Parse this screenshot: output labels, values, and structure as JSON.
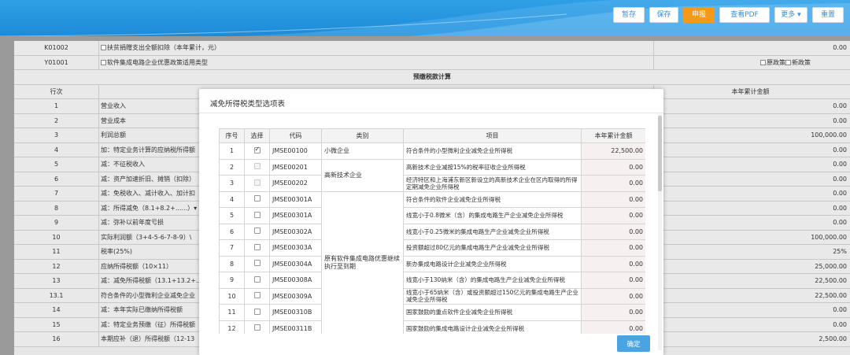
{
  "toolbar": {
    "buttons": [
      "暂存",
      "保存",
      "申报",
      "查看PDF",
      "更多",
      "重置"
    ]
  },
  "bg": {
    "rows": [
      {
        "code": "K01002",
        "label": "扶贫捐赠支出全额扣除（本年累计，元）",
        "value": "0.00",
        "checkbox": true
      },
      {
        "code": "Y01001",
        "label": "软件集成电路企业优惠政策适用类型",
        "value": "",
        "checkbox": true
      },
      {
        "code": "",
        "label": "预缴税款计算",
        "value": ""
      },
      {
        "code": "行次",
        "label": "",
        "value": "本年累计金额"
      },
      {
        "code": "1",
        "label": "营业收入",
        "value": "0.00"
      },
      {
        "code": "2",
        "label": "营业成本",
        "value": "0.00"
      },
      {
        "code": "3",
        "label": "利润总额",
        "value": "100,000.00"
      },
      {
        "code": "4",
        "label": "加：特定业务计算的应纳税所得额",
        "value": "0.00"
      },
      {
        "code": "5",
        "label": "减：不征税收入",
        "value": "0.00"
      },
      {
        "code": "6",
        "label": "减：资产加速折旧、摊销（扣除）",
        "value": "0.00"
      },
      {
        "code": "7",
        "label": "减：免税收入、减计收入、加计扣",
        "value": "0.00"
      },
      {
        "code": "8",
        "label": "减：所得减免（8.1+8.2+......）▾",
        "value": "0.00"
      },
      {
        "code": "9",
        "label": "减：弥补以前年度亏损",
        "value": "0.00"
      },
      {
        "code": "10",
        "label": "实际利润额（3+4-5-6-7-8-9）\\",
        "value": "100,000.00"
      },
      {
        "code": "11",
        "label": "税率(25%)",
        "value": "25%"
      },
      {
        "code": "12",
        "label": "应纳所得税额（10×11）",
        "value": "25,000.00"
      },
      {
        "code": "13",
        "label": "减：减免所得税额（13.1+13.2+...",
        "value": "22,500.00"
      },
      {
        "code": "13.1",
        "label": "符合条件的小型微利企业减免企业",
        "value": "22,500.00"
      },
      {
        "code": "14",
        "label": "减：本年实际已缴纳所得税额",
        "value": "0.00"
      },
      {
        "code": "15",
        "label": "减：特定业务预缴（征）所得税额",
        "value": "0.00"
      },
      {
        "code": "16",
        "label": "本期应补（退）所得税额（12-13",
        "value": "2,500.00"
      }
    ],
    "policy_options": [
      "原政策",
      "新政策"
    ]
  },
  "modal": {
    "title": "减免所得税类型选项表",
    "columns": [
      "序号",
      "选择",
      "代码",
      "类别",
      "项目",
      "本年累计金额"
    ],
    "rows": [
      {
        "no": "1",
        "checked": true,
        "disabled": false,
        "code": "JMSE00100",
        "item": "符合条件的小型微利企业减免企业所得税",
        "amount": "22,500.00"
      },
      {
        "no": "2",
        "checked": false,
        "disabled": true,
        "code": "JMSE00201",
        "item": "高新技术企业减按15%的税率征收企业所得税",
        "amount": "0.00"
      },
      {
        "no": "3",
        "checked": false,
        "disabled": true,
        "code": "JMSE00202",
        "item": "经济特区和上海浦东新区新设立的高新技术企业在区内取得的所得定期减免企业所得税",
        "amount": "0.00"
      },
      {
        "no": "4",
        "checked": false,
        "disabled": false,
        "code": "JMSE00301A",
        "item": "符合条件的软件企业减免企业所得税",
        "amount": "0.00"
      },
      {
        "no": "5",
        "checked": false,
        "disabled": false,
        "code": "JMSE00301A",
        "item": "线宽小于0.8微米（含）的集成电路生产企业减免企业所得税",
        "amount": "0.00"
      },
      {
        "no": "6",
        "checked": false,
        "disabled": false,
        "code": "JMSE00302A",
        "item": "线宽小于0.25微米的集成电路生产企业减免企业所得税",
        "amount": "0.00"
      },
      {
        "no": "7",
        "checked": false,
        "disabled": false,
        "code": "JMSE00303A",
        "item": "投资额超过80亿元的集成电路生产企业减免企业所得税",
        "amount": "0.00"
      },
      {
        "no": "8",
        "checked": false,
        "disabled": false,
        "code": "JMSE00304A",
        "item": "新办集成电路设计企业减免企业所得税",
        "amount": "0.00"
      },
      {
        "no": "9",
        "checked": false,
        "disabled": false,
        "code": "JMSE00308A",
        "item": "线宽小于130纳米（含）的集成电路生产企业减免企业所得税",
        "amount": "0.00"
      },
      {
        "no": "10",
        "checked": false,
        "disabled": false,
        "code": "JMSE00309A",
        "item": "线宽小于65纳米（含）或投资额超过150亿元的集成电路生产企业减免企业所得税",
        "amount": "0.00"
      },
      {
        "no": "11",
        "checked": false,
        "disabled": false,
        "code": "JMSE00310B",
        "item": "国家鼓励的重点软件企业减免企业所得税",
        "amount": "0.00"
      },
      {
        "no": "12",
        "checked": false,
        "disabled": false,
        "code": "JMSE00311B",
        "item": "国家鼓励的集成电路设计企业减免企业所得税",
        "amount": "0.00"
      }
    ],
    "categories": [
      {
        "label": "小微企业",
        "start": 0,
        "span": 1
      },
      {
        "label": "高新技术企业",
        "start": 1,
        "span": 2
      },
      {
        "label": "原有软件集成电路优惠继续执行至到期",
        "start": 3,
        "span": 9
      }
    ],
    "confirm_label": "确定"
  }
}
